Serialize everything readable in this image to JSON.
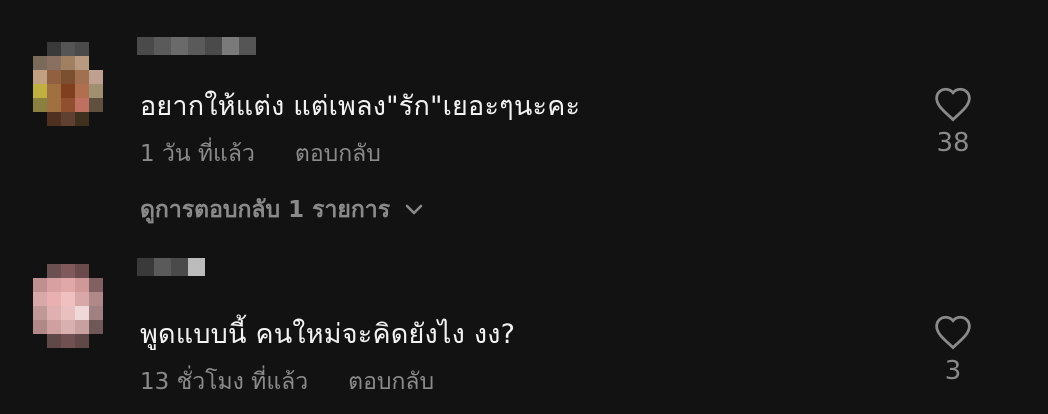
{
  "comments": [
    {
      "text": "อยากให้แต่ง แต่เพลง\"รัก\"เยอะๆนะคะ",
      "time": "1 วัน ที่แล้ว",
      "reply_label": "ตอบกลับ",
      "likes": "38",
      "heart_icon": "heart-outline-icon",
      "avatar_colors": [
        "#121212",
        "#3a3a3a",
        "#555555",
        "#4a4a4a",
        "#121212",
        "#7a6a5a",
        "#8a7060",
        "#a08060",
        "#b89a80",
        "#121212",
        "#c0a080",
        "#906040",
        "#7a5030",
        "#a07050",
        "#c0a090",
        "#c0b040",
        "#a07040",
        "#804020",
        "#b07050",
        "#a09070",
        "#8a8040",
        "#a07040",
        "#905030",
        "#c07060",
        "#605040",
        "#121212",
        "#503020",
        "#604030",
        "#403020",
        "#121212"
      ],
      "username_colors": [
        "#4a4a4a",
        "#5a5a5a",
        "#6a6a6a",
        "#5a5a5a",
        "#4a4a4a",
        "#7a7a7a",
        "#555555"
      ]
    },
    {
      "text": "พูดแบบนี้ คนใหม่จะคิดยังไง งง?",
      "time": "13 ชั่วโมง ที่แล้ว",
      "reply_label": "ตอบกลับ",
      "likes": "3",
      "heart_icon": "heart-outline-icon",
      "avatar_colors": [
        "#121212",
        "#6a5050",
        "#805a5a",
        "#6a4a4a",
        "#121212",
        "#c09090",
        "#d8a0a0",
        "#e0a8a8",
        "#d09898",
        "#806060",
        "#d8a8a8",
        "#e8b0b0",
        "#f0c0c0",
        "#d8a8a8",
        "#b08888",
        "#c09898",
        "#e0b0b0",
        "#e8c0c0",
        "#f0d8d8",
        "#a08080",
        "#b08888",
        "#d0a0a0",
        "#d8b0b0",
        "#c8a0a0",
        "#705858",
        "#121212",
        "#604848",
        "#705050",
        "#604848",
        "#121212"
      ],
      "username_colors": [
        "#3a3a3a",
        "#5a5a5a",
        "#4a4a4a",
        "#bcbcbc"
      ]
    }
  ],
  "view_replies": {
    "label": "ดูการตอบกลับ 1 รายการ",
    "icon": "chevron-down-icon"
  }
}
